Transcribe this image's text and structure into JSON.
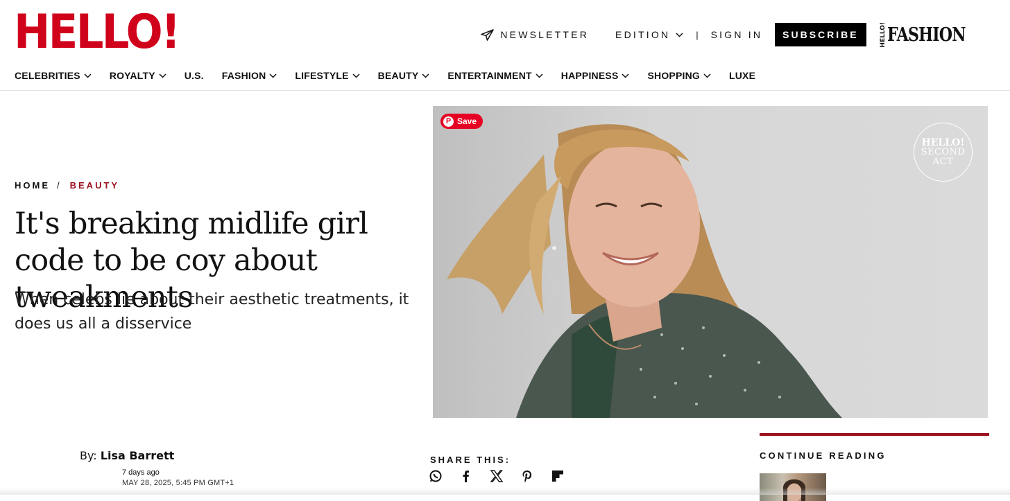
{
  "brand": {
    "logo_text": "HELLO!",
    "logo_color": "#d0021b"
  },
  "topnav": {
    "newsletter": "NEWSLETTER",
    "edition": "EDITION",
    "separator": "|",
    "sign_in": "SIGN IN",
    "subscribe": "SUBSCRIBE",
    "fashion_mini": "HELLO!",
    "fashion_word": "FASHION"
  },
  "mainnav": [
    {
      "label": "CELEBRITIES",
      "has_dropdown": true
    },
    {
      "label": "ROYALTY",
      "has_dropdown": true
    },
    {
      "label": "U.S.",
      "has_dropdown": false
    },
    {
      "label": "FASHION",
      "has_dropdown": true
    },
    {
      "label": "LIFESTYLE",
      "has_dropdown": true
    },
    {
      "label": "BEAUTY",
      "has_dropdown": true
    },
    {
      "label": "ENTERTAINMENT",
      "has_dropdown": true
    },
    {
      "label": "HAPPINESS",
      "has_dropdown": true
    },
    {
      "label": "SHOPPING",
      "has_dropdown": true
    },
    {
      "label": "LUXE",
      "has_dropdown": false
    }
  ],
  "breadcrumb": {
    "home": "HOME",
    "separator": "/",
    "section": "BEAUTY",
    "section_color": "#9b111e"
  },
  "article": {
    "headline": "It's breaking midlife girl code to be coy about tweakments",
    "standfirst": "When celebs lie about their aesthetic treatments, it does us all a disservice",
    "byline_prefix": "By:",
    "author": "Lisa Barrett",
    "relative_time": "7 days ago",
    "published": "MAY 28, 2025, 5:45 PM GMT+1"
  },
  "hero": {
    "pinterest_save": "Save",
    "badge_line1": "HELLO!",
    "badge_line2": "SECOND",
    "badge_line3": "ACT"
  },
  "share": {
    "label": "SHARE THIS:",
    "icons": [
      "whatsapp-icon",
      "facebook-icon",
      "x-icon",
      "pinterest-icon",
      "flipboard-icon"
    ]
  },
  "continue_reading": {
    "label": "CONTINUE READING",
    "accent": "#9b111e"
  }
}
